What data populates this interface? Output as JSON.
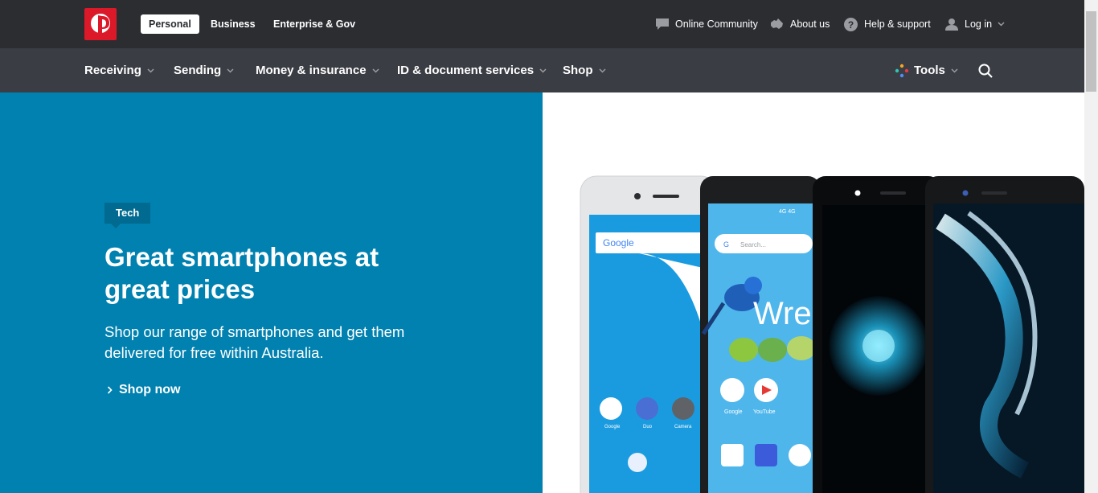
{
  "segments": {
    "personal": "Personal",
    "business": "Business",
    "enterprise": "Enterprise & Gov"
  },
  "utility": {
    "community": "Online Community",
    "about": "About us",
    "help": "Help & support",
    "login": "Log in"
  },
  "nav": {
    "receiving": "Receiving",
    "sending": "Sending",
    "money": "Money & insurance",
    "id": "ID & document services",
    "shop": "Shop",
    "tools": "Tools"
  },
  "hero": {
    "tag": "Tech",
    "headline": "Great smartphones at great prices",
    "sub": "Shop our range of smartphones and get them delivered for free within Australia.",
    "cta": "Shop now"
  },
  "phones": {
    "google_label": "Google",
    "search_placeholder": "Search...",
    "wren": "Wre",
    "app_google": "Google",
    "app_youtube": "YouTube",
    "app_duo": "Duo",
    "app_camera": "Camera"
  },
  "colors": {
    "brand_red": "#dc1928",
    "topbar": "#2b2d31",
    "navbar": "#3a3d43",
    "hero_blue": "#0081b0",
    "tag_bg": "#006a91"
  }
}
